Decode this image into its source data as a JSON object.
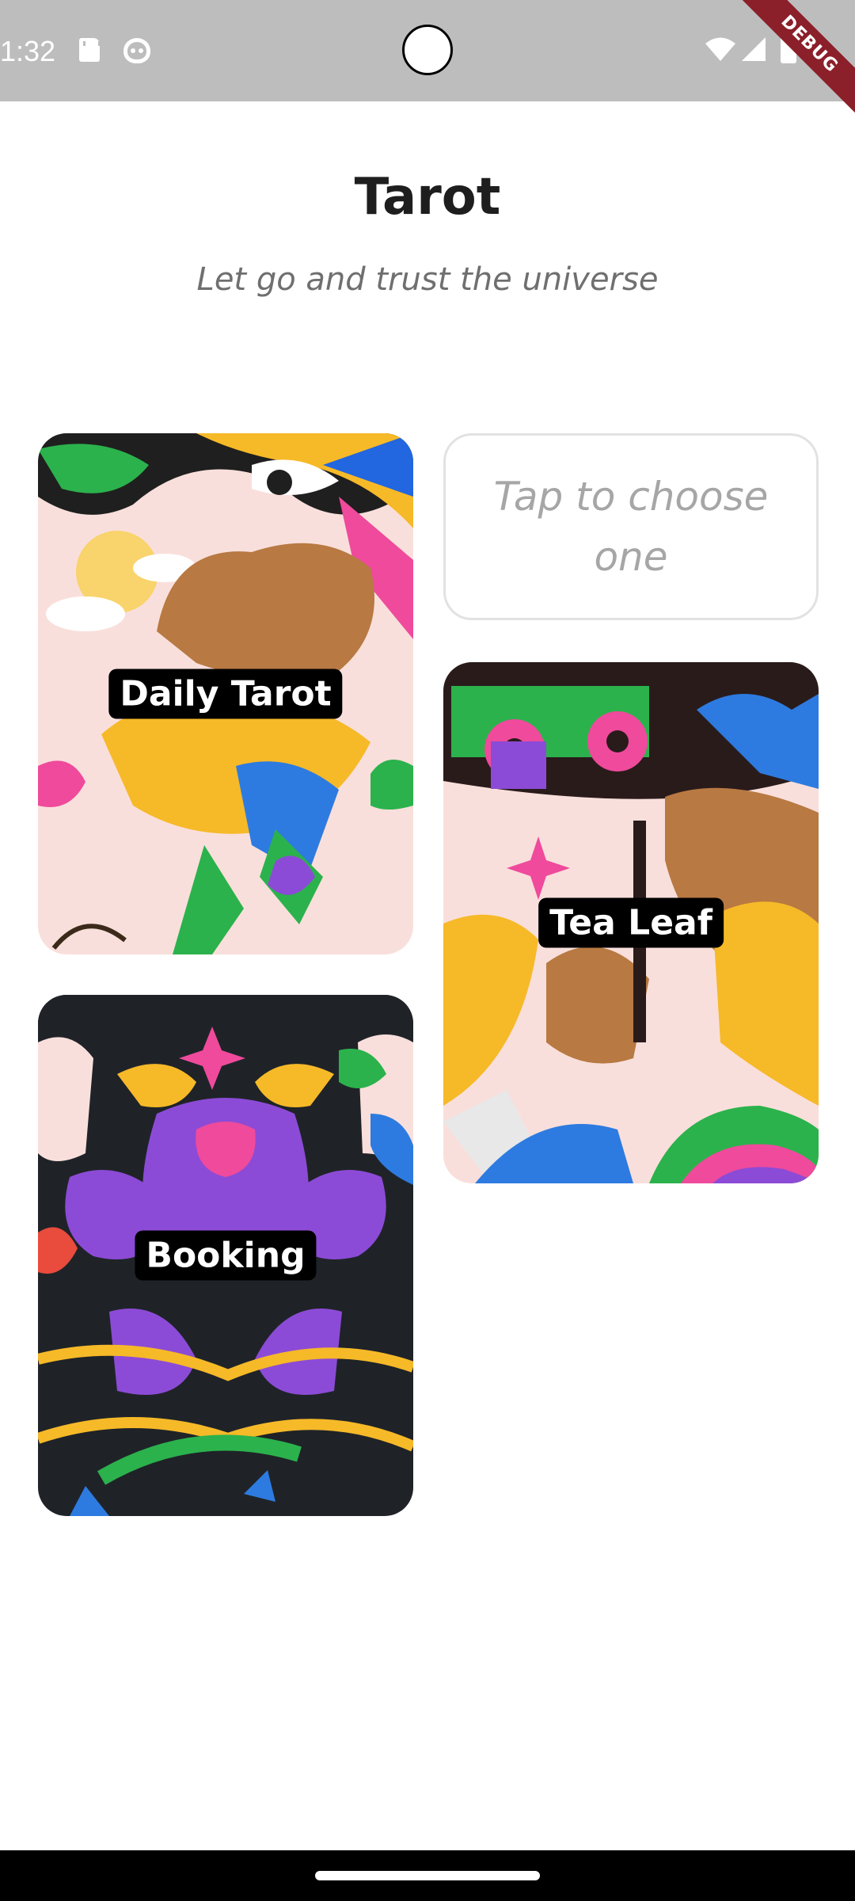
{
  "status_bar": {
    "time": "1:32",
    "debug_label": "DEBUG",
    "icons": [
      "sd-card-icon",
      "android-debug-icon",
      "camera-cutout",
      "wifi-icon",
      "signal-icon",
      "battery-icon"
    ]
  },
  "header": {
    "title": "Tarot",
    "subtitle": "Let go and trust the universe"
  },
  "cards": {
    "daily_tarot": {
      "label": "Daily Tarot"
    },
    "booking": {
      "label": "Booking"
    },
    "tea_leaf": {
      "label": "Tea Leaf"
    }
  },
  "choose_box": {
    "text": "Tap to choose one"
  },
  "colors": {
    "status_bar": "#bdbdbd",
    "debug_banner": "#8b1f2a",
    "label_bg": "#000000",
    "hint_text": "#a6a6a6",
    "subtitle_text": "#6f6f6f"
  }
}
